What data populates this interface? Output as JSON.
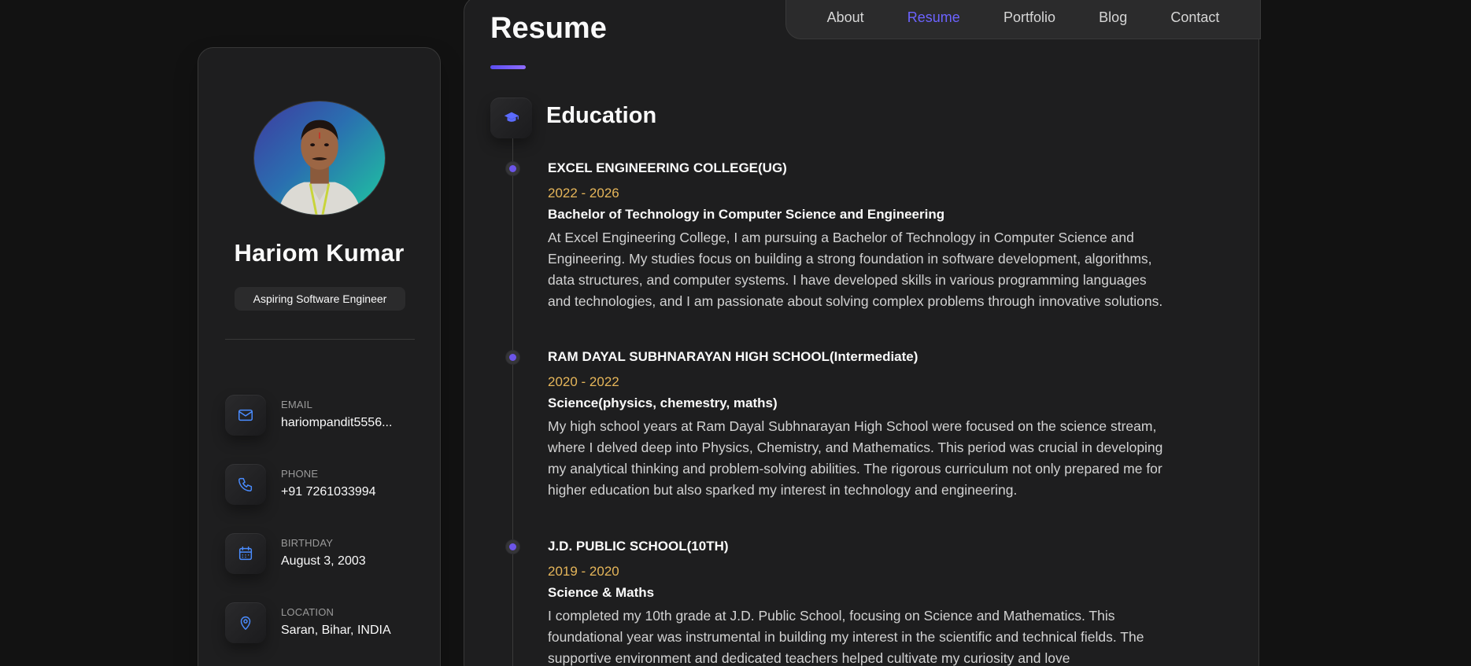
{
  "nav": {
    "items": [
      {
        "label": "About",
        "active": false
      },
      {
        "label": "Resume",
        "active": true
      },
      {
        "label": "Portfolio",
        "active": false
      },
      {
        "label": "Blog",
        "active": false
      },
      {
        "label": "Contact",
        "active": false
      }
    ]
  },
  "profile": {
    "name": "Hariom Kumar",
    "title": "Aspiring Software Engineer",
    "contacts": [
      {
        "label": "EMAIL",
        "value": "hariompandit5556...",
        "icon": "mail-icon"
      },
      {
        "label": "PHONE",
        "value": "+91 7261033994",
        "icon": "phone-icon"
      },
      {
        "label": "BIRTHDAY",
        "value": "August 3, 2003",
        "icon": "calendar-icon"
      },
      {
        "label": "LOCATION",
        "value": "Saran, Bihar, INDIA",
        "icon": "location-pin-icon"
      }
    ]
  },
  "page": {
    "title": "Resume",
    "section_title": "Education",
    "section_icon": "graduation-cap-icon"
  },
  "education": [
    {
      "school": "EXCEL ENGINEERING COLLEGE(UG)",
      "years": "2022 - 2026",
      "degree": "Bachelor of Technology in Computer Science and Engineering",
      "description": "At Excel Engineering College, I am pursuing a Bachelor of Technology in Computer Science and Engineering. My studies focus on building a strong foundation in software development, algorithms, data structures, and computer systems. I have developed skills in various programming languages and technologies, and I am passionate about solving complex problems through innovative solutions."
    },
    {
      "school": "RAM DAYAL SUBHNARAYAN HIGH SCHOOL(Intermediate)",
      "years": "2020 - 2022",
      "degree": "Science(physics, chemestry, maths)",
      "description": "My high school years at Ram Dayal Subhnarayan High School were focused on the science stream, where I delved deep into Physics, Chemistry, and Mathematics. This period was crucial in developing my analytical thinking and problem-solving abilities. The rigorous curriculum not only prepared me for higher education but also sparked my interest in technology and engineering."
    },
    {
      "school": "J.D. PUBLIC SCHOOL(10TH)",
      "years": "2019 - 2020",
      "degree": "Science & Maths",
      "description": "I completed my 10th grade at J.D. Public School, focusing on Science and Mathematics. This foundational year was instrumental in building my interest in the scientific and technical fields. The supportive environment and dedicated teachers helped cultivate my curiosity and love"
    }
  ],
  "colors": {
    "accent": "#6c63ff",
    "years": "#e6b65a",
    "icon": "#4a8cff",
    "background": "#121212",
    "card": "#1e1e1f"
  }
}
